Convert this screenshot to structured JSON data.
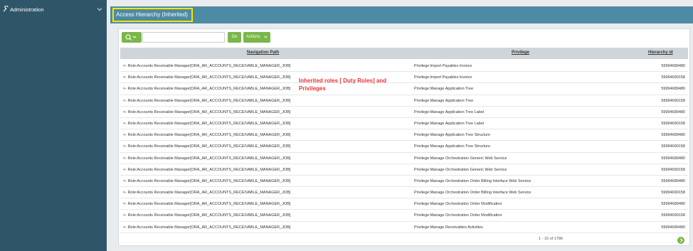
{
  "sidebar": {
    "items": [
      {
        "label": "Administration"
      }
    ]
  },
  "header": {
    "title": "Access Hierarchy (Inherited)"
  },
  "toolbar": {
    "search_value": "",
    "go_label": "Go",
    "actions_label": "Actions"
  },
  "table": {
    "columns": [
      "Navigation Path",
      "Privilege",
      "Hierarchy id"
    ],
    "rows": [
      {
        "nav": "<- Role:Accounts Receivable Manager[ORA_AR_ACCOUNTS_RECEIVABLE_MANAGER_JOB]",
        "priv": "Privilege:Import Payables Invoice",
        "hid": "59994689480"
      },
      {
        "nav": "<- Role:Accounts Receivable Manager[ORA_AR_ACCOUNTS_RECEIVABLE_MANAGER_JOB]",
        "priv": "Privilege:Import Payables Invoice",
        "hid": "59994690158"
      },
      {
        "nav": "<- Role:Accounts Receivable Manager[ORA_AR_ACCOUNTS_RECEIVABLE_MANAGER_JOB]",
        "priv": "Privilege:Manage Application Tree",
        "hid": "59994689480"
      },
      {
        "nav": "<- Role:Accounts Receivable Manager[ORA_AR_ACCOUNTS_RECEIVABLE_MANAGER_JOB]",
        "priv": "Privilege:Manage Application Tree",
        "hid": "59994690158"
      },
      {
        "nav": "<- Role:Accounts Receivable Manager[ORA_AR_ACCOUNTS_RECEIVABLE_MANAGER_JOB]",
        "priv": "Privilege:Manage Application Tree Label",
        "hid": "59994689480"
      },
      {
        "nav": "<- Role:Accounts Receivable Manager[ORA_AR_ACCOUNTS_RECEIVABLE_MANAGER_JOB]",
        "priv": "Privilege:Manage Application Tree Label",
        "hid": "59994690158"
      },
      {
        "nav": "<- Role:Accounts Receivable Manager[ORA_AR_ACCOUNTS_RECEIVABLE_MANAGER_JOB]",
        "priv": "Privilege:Manage Application Tree Structure",
        "hid": "59994689480"
      },
      {
        "nav": "<- Role:Accounts Receivable Manager[ORA_AR_ACCOUNTS_RECEIVABLE_MANAGER_JOB]",
        "priv": "Privilege:Manage Application Tree Structure",
        "hid": "59994690158"
      },
      {
        "nav": "<- Role:Accounts Receivable Manager[ORA_AR_ACCOUNTS_RECEIVABLE_MANAGER_JOB]",
        "priv": "Privilege:Manage Orchestration Generic Web Service",
        "hid": "59994689480"
      },
      {
        "nav": "<- Role:Accounts Receivable Manager[ORA_AR_ACCOUNTS_RECEIVABLE_MANAGER_JOB]",
        "priv": "Privilege:Manage Orchestration Generic Web Service",
        "hid": "59994690158"
      },
      {
        "nav": "<- Role:Accounts Receivable Manager[ORA_AR_ACCOUNTS_RECEIVABLE_MANAGER_JOB]",
        "priv": "Privilege:Manage Orchestration Order Billing Interface Web Service",
        "hid": "59994689480"
      },
      {
        "nav": "<- Role:Accounts Receivable Manager[ORA_AR_ACCOUNTS_RECEIVABLE_MANAGER_JOB]",
        "priv": "Privilege:Manage Orchestration Order Billing Interface Web Service",
        "hid": "59994690158"
      },
      {
        "nav": "<- Role:Accounts Receivable Manager[ORA_AR_ACCOUNTS_RECEIVABLE_MANAGER_JOB]",
        "priv": "Privilege:Manage Orchestration Order Modification",
        "hid": "59994689480"
      },
      {
        "nav": "<- Role:Accounts Receivable Manager[ORA_AR_ACCOUNTS_RECEIVABLE_MANAGER_JOB]",
        "priv": "Privilege:Manage Orchestration Order Modification",
        "hid": "59994690158"
      },
      {
        "nav": "<- Role:Accounts Receivable Manager[ORA_AR_ACCOUNTS_RECEIVABLE_MANAGER_JOB]",
        "priv": "Privilege:Manage Receivables Activities",
        "hid": "59994689480"
      }
    ]
  },
  "annotation": {
    "text": "Inherited roles [ Duty Roles] and Privileges"
  },
  "pager": {
    "text": "1 - 15 of 1786"
  },
  "icons": {
    "sidebar": "admin-tools-icon",
    "search": "search-icon",
    "next": "next-page-icon"
  },
  "colors": {
    "sidebar_bg": "#2f5668",
    "header_bg": "#4d8aa3",
    "accent_green": "#7ab648",
    "highlight_yellow": "#f5e600",
    "annotation_red": "#e8333a"
  }
}
